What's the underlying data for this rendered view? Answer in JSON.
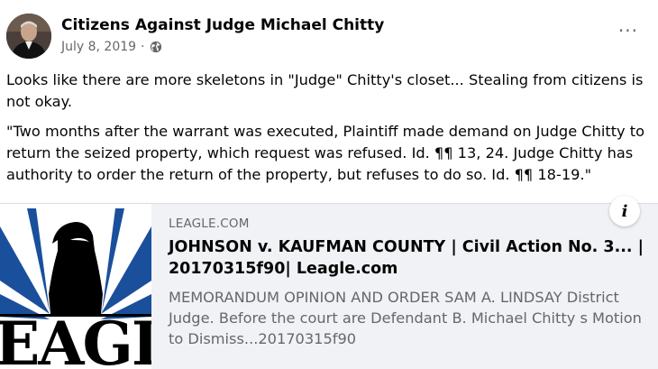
{
  "post": {
    "author": "Citizens Against Judge Michael Chitty",
    "date": "July 8, 2019",
    "separator": "·",
    "audience_icon": "globe-icon",
    "more_icon": "more-options-icon",
    "more_label": "···",
    "paragraphs": [
      "Looks like there are more skeletons in \"Judge\" Chitty's closet... Stealing from citizens is not okay.",
      "\"Two months after the warrant was executed, Plaintiff made demand on Judge Chitty to return the seized property, which request was refused. Id. ¶¶ 13, 24. Judge Chitty has authority to order the return of the property, but refuses to do so. Id. ¶¶ 18-19.\""
    ]
  },
  "link_preview": {
    "domain": "LEAGLE.COM",
    "title": "JOHNSON v. KAUFMAN COUNTY | Civil Action No. 3... | 20170315f90| Leagle.com",
    "description": "MEMORANDUM OPINION AND ORDER SAM A. LINDSAY District Judge. Before the court are Defendant B. Michael Chitty s Motion to Dismiss...20170315f90",
    "info_label": "i",
    "logo_text": "EAGL",
    "colors": {
      "logo_blue": "#1a4f9c",
      "bird": "#000000"
    }
  }
}
